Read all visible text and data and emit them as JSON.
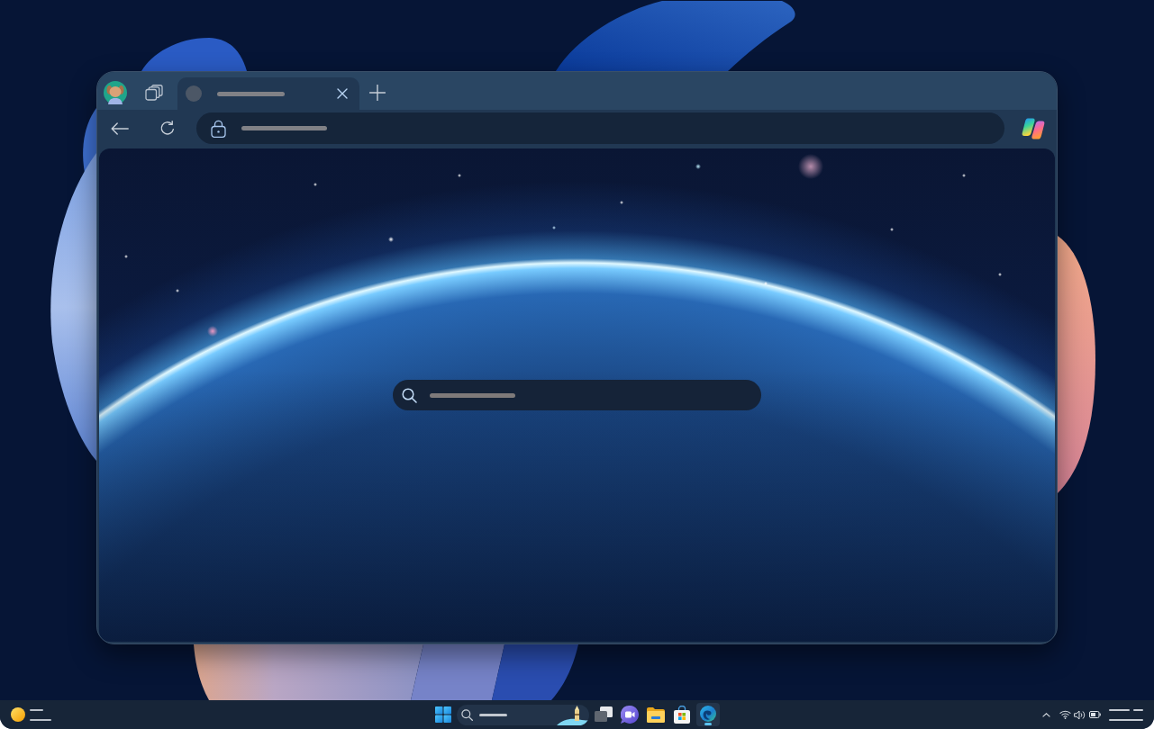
{
  "browser": {
    "tabs": [
      {
        "selected": true
      }
    ]
  },
  "taskbar": {
    "apps": [
      {
        "kind": "task-view",
        "selected": false
      },
      {
        "kind": "meet",
        "selected": false
      },
      {
        "kind": "folder",
        "selected": false
      },
      {
        "kind": "store",
        "selected": false
      },
      {
        "kind": "browser",
        "selected": true
      }
    ]
  }
}
